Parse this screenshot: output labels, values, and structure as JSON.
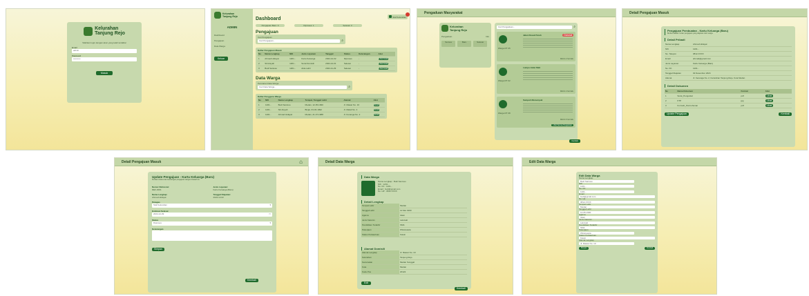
{
  "login": {
    "brand": [
      "Kelurahan",
      "Tanjung Rejo"
    ],
    "welcome": "Silahkan login dengan akun yang telah terdaftar",
    "email_label": "Email",
    "email_value": "admin",
    "password_label": "Password",
    "password_value": "••••••••••",
    "submit": "Masuk"
  },
  "dashboard": {
    "brand": [
      "Kelurahan",
      "Tanjung Rejo"
    ],
    "role": "ADMIN",
    "nav": [
      "Dashboard",
      "Pengajuan",
      "Data Warga"
    ],
    "logout": "Keluar",
    "user_badge": "Staf Kelurahan",
    "title": "Dashboard",
    "stats": [
      "Pengajuan Baru: 0",
      "Diproses: 1",
      "Selesai: 3"
    ],
    "pengajuan_title": "Pengajuan",
    "cari_pengajuan_label": "Cari Pengajuan",
    "cari_pengajuan_placeholder": "Cari Pengajuan...",
    "daftar_masuk_title": "Daftar Pengajuan Masuk",
    "masuk_headers": [
      "No",
      "Nama Lengkap",
      "NIK",
      "Jenis Layanan",
      "Tanggal",
      "Status",
      "Keterangan",
      "Aksi"
    ],
    "masuk_rows": [
      [
        "1",
        "Ahmad Hidayat",
        "1201...",
        "Kartu Keluarga",
        "2024-12-02",
        "Diproses",
        "-",
        "Lihat Detail"
      ],
      [
        "2",
        "Siti Aisyah",
        "1201...",
        "Surat Domisili",
        "2024-12-01",
        "Selesai",
        "-",
        "Lihat Detail"
      ],
      [
        "3",
        "Budi Santoso",
        "1201...",
        "Akta Lahir",
        "2024-11-29",
        "Selesai",
        "-",
        "Lihat Detail"
      ]
    ],
    "warga_title": "Data Warga",
    "cari_warga_label": "Pencarian Data Warga",
    "cari_warga_placeholder": "Cari Data Warga...",
    "daftar_warga_title": "Daftar Pengguna Warga",
    "warga_headers": [
      "No",
      "NIK",
      "Nama Lengkap",
      "Tempat, Tanggal Lahir",
      "Alamat",
      "Aksi"
    ],
    "warga_rows": [
      [
        "1",
        "1201...",
        "Budi Santoso",
        "Medan, 12-05-1990",
        "Jl. Mawar No. 10",
        "Detail"
      ],
      [
        "2",
        "1201...",
        "Siti Aisyah",
        "Binjai, 03-03-1992",
        "Jl. Melati No. 4",
        "Detail"
      ],
      [
        "3",
        "1201...",
        "Ahmad Hidayat",
        "Medan, 21-07-1988",
        "Jl. Kenanga No. 2",
        "Detail"
      ]
    ]
  },
  "pengaduan": {
    "header": "Pengaduan Masyarakat",
    "brand": [
      "Kelurahan",
      "Tanjung Rejo"
    ],
    "side_menu": [
      "Pengaduan",
      "Info"
    ],
    "filters": [
      "Semua",
      "Baru",
      "Selesai"
    ],
    "search_placeholder": "Cari Pengaduan...",
    "items": [
      {
        "title": "Jalan Rusak Parah",
        "badge": "Darurat",
        "from": "Warga RT 05",
        "date": "Dikirim 2 hari lalu"
      },
      {
        "title": "Lampu Jalan Mati",
        "badge": "",
        "from": "Warga RT 02",
        "date": "Dikirim 4 hari lalu"
      },
      {
        "title": "Sampah Menumpuk",
        "badge": "",
        "from": "Warga RT 08",
        "date": "Dikirim 6 hari lalu"
      }
    ],
    "detail_button": "Lihat Semua Pengaduan",
    "back": "Kembali"
  },
  "detail_masuk": {
    "header": "Detail Pengajuan Masuk",
    "title": "Pengajuan Pembuatan - Kartu Keluarga (Baru)",
    "subtitle": "Berikut adalah rincian pengajuan yang diajukan oleh warga.",
    "pribadi_title": "Detail Pribadi",
    "pribadi_rows": [
      [
        "Nama Lengkap",
        "Ahmad Hidayat"
      ],
      [
        "NIK",
        "1201..."
      ],
      [
        "No. Telepon",
        "0812-XXXX"
      ],
      [
        "Email",
        "ahmad@gmail.com"
      ],
      [
        "Jenis Layanan",
        "Kartu Keluarga (Baru)"
      ],
      [
        "No. KK",
        "1201..."
      ],
      [
        "Tanggal Diajukan",
        "02 Desember 2024"
      ],
      [
        "Alamat",
        "Jl. Kenanga No. 2, Kelurahan Tanjung Rejo, Kota Medan"
      ]
    ],
    "dokumen_title": "Detail Dokumen",
    "dokumen_headers": [
      "No",
      "Nama Dokumen",
      "Format",
      "Aksi"
    ],
    "dokumen_rows": [
      [
        "1",
        "Surat_Pengantar",
        "pdf",
        "Lihat"
      ],
      [
        "2",
        "KTP",
        "jpg",
        "Lihat"
      ],
      [
        "3",
        "Formulir_Permohonan",
        "pdf",
        "Lihat"
      ]
    ],
    "update_button": "Update Pengajuan",
    "back": "Kembali"
  },
  "detail_update": {
    "header": "Detail Pengajuan Masuk",
    "title": "Update Pengajuan - Kartu Keluarga (Baru)",
    "subtitle": "Perbarui status dan keterangan pengajuan warga di bawah ini.",
    "fields": [
      [
        "Nomor Referensi:",
        "REF-0001"
      ],
      [
        "Jenis Layanan:",
        "Kartu Keluarga (Baru)"
      ],
      [
        "Nama Lengkap:",
        "Ahmad Hidayat"
      ],
      [
        "Tanggal Diajukan:",
        "2024-12-02"
      ]
    ],
    "petugas_label": "Petugas",
    "petugas_value": "Staf Kelurahan",
    "estimasi_label": "Estimasi Selesai",
    "estimasi_value": "2024-12-09",
    "status_label": "Status",
    "status_value": "Diproses",
    "keterangan_label": "Keterangan",
    "save": "Simpan",
    "back": "Kembali"
  },
  "detail_warga": {
    "header": "Detail Data Warga",
    "section": "Data Warga",
    "summary": [
      "Nama Lengkap : Budi Santoso",
      "NIK : 1201...",
      "No. KK : 1201...",
      "Email : budi@gmail.com",
      "No. HP : 0812-XXXX"
    ],
    "lengkap_title": "Detail Lengkap",
    "lengkap_rows": [
      [
        "Tempat Lahir",
        "Medan"
      ],
      [
        "Tanggal Lahir",
        "12 Mei 1990"
      ],
      [
        "Agama",
        "Islam"
      ],
      [
        "Jenis Kelamin",
        "Laki-laki"
      ],
      [
        "Pendidikan Terakhir",
        "SMA"
      ],
      [
        "Pekerjaan",
        "Wiraswasta"
      ],
      [
        "Status Perkawinan",
        "Kawin"
      ]
    ],
    "domisili_title": "Alamat Domisili",
    "domisili_rows": [
      [
        "Alamat Lengkap",
        "Jl. Mawar No. 10"
      ],
      [
        "Kelurahan",
        "Tanjung Rejo"
      ],
      [
        "Kecamatan",
        "Medan Sunggal"
      ],
      [
        "Kota",
        "Medan"
      ],
      [
        "Kode Pos",
        "20122"
      ]
    ],
    "edit": "Edit",
    "back": "Kembali"
  },
  "edit_warga": {
    "header": "Edit Data Warga",
    "title": "Edit Data Warga",
    "fields": [
      [
        "Nama Lengkap",
        "Budi Santoso"
      ],
      [
        "NIK",
        "1201..."
      ],
      [
        "No. KK",
        "1201..."
      ],
      [
        "Email",
        "budi@gmail.com"
      ],
      [
        "No. Hp",
        "0812-XXXX"
      ],
      [
        "Tempat Lahir",
        "Medan"
      ],
      [
        "Tanggal Lahir",
        "12-05-1990"
      ],
      [
        "Agama",
        "Islam"
      ],
      [
        "Jenis Kelamin",
        "Laki-laki"
      ],
      [
        "Pendidikan Terakhir",
        "SMA"
      ],
      [
        "Pekerjaan",
        "Wiraswasta"
      ],
      [
        "Status Perkawinan",
        "Kawin"
      ],
      [
        "Alamat Lengkap",
        "Jl. Mawar No. 10"
      ]
    ],
    "save": "Simpan",
    "back": "Kembali"
  }
}
